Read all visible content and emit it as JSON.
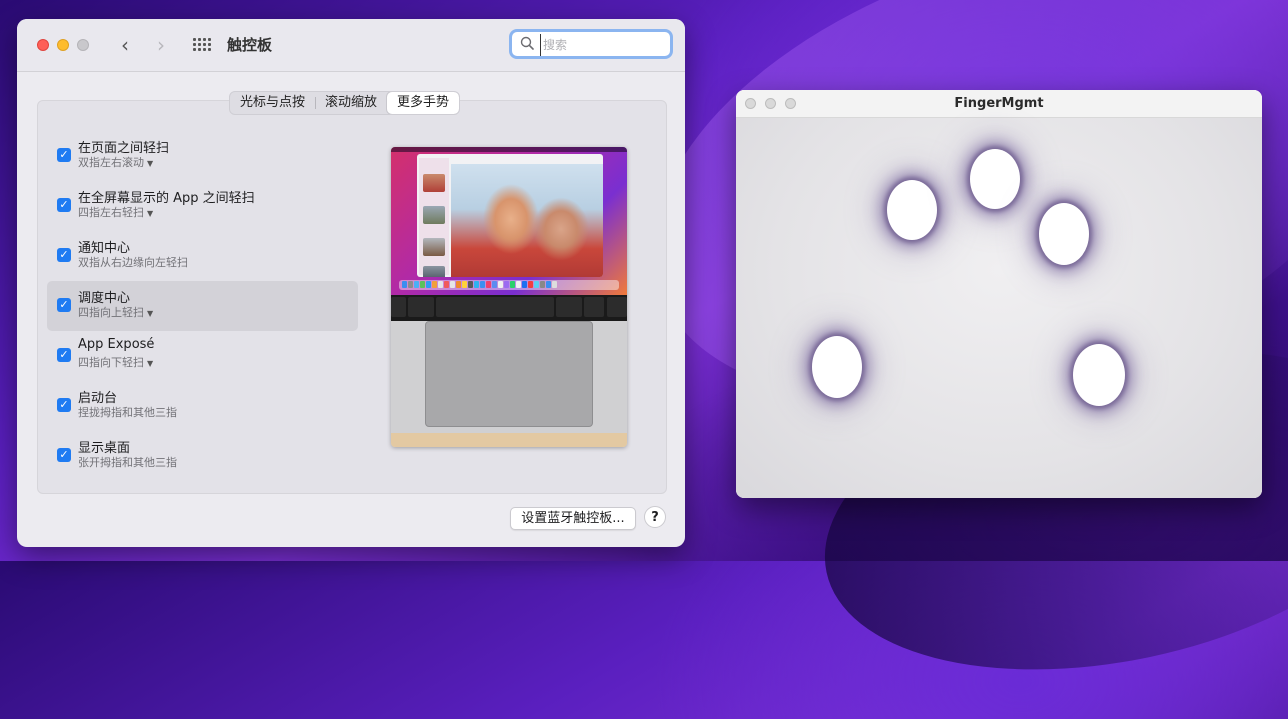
{
  "prefs": {
    "title": "触控板",
    "search_placeholder": "搜索",
    "tabs": [
      {
        "label": "光标与点按"
      },
      {
        "label": "滚动缩放"
      },
      {
        "label": "更多手势",
        "active": true
      }
    ],
    "gestures": [
      {
        "title": "在页面之间轻扫",
        "subtitle": "双指左右滚动",
        "checked": true,
        "has_dropdown": true,
        "selected": false
      },
      {
        "title": "在全屏幕显示的 App 之间轻扫",
        "subtitle": "四指左右轻扫",
        "checked": true,
        "has_dropdown": true,
        "selected": false
      },
      {
        "title": "通知中心",
        "subtitle": "双指从右边缘向左轻扫",
        "checked": true,
        "has_dropdown": false,
        "selected": false
      },
      {
        "title": "调度中心",
        "subtitle": "四指向上轻扫",
        "checked": true,
        "has_dropdown": true,
        "selected": true
      },
      {
        "title": "App Exposé",
        "subtitle": "四指向下轻扫",
        "checked": true,
        "has_dropdown": true,
        "selected": false
      },
      {
        "title": "启动台",
        "subtitle": "捏拢拇指和其他三指",
        "checked": true,
        "has_dropdown": false,
        "selected": false
      },
      {
        "title": "显示桌面",
        "subtitle": "张开拇指和其他三指",
        "checked": true,
        "has_dropdown": false,
        "selected": false
      }
    ],
    "bluetooth_button": "设置蓝牙触控板...",
    "help_button": "?"
  },
  "fingermgmt": {
    "title": "FingerMgmt",
    "touch_count": 5
  },
  "colors": {
    "accent": "#1f7bf2",
    "close": "#fe5f57",
    "minimize": "#febc2e"
  }
}
